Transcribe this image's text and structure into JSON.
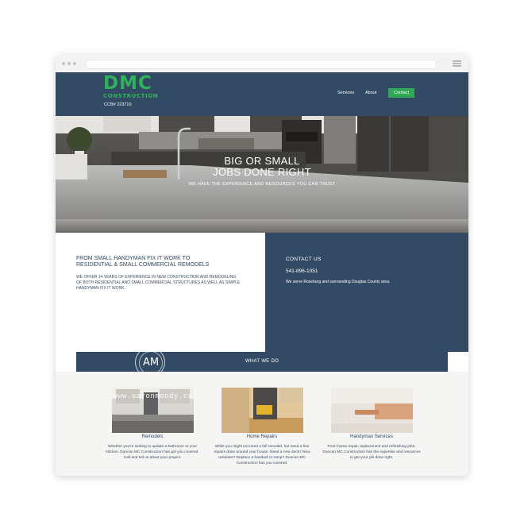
{
  "header": {
    "logo_main": "DMC",
    "logo_sub": "CONSTRUCTION",
    "ccb": "CCB# 223710",
    "nav": [
      "Services",
      "About"
    ],
    "contact_button": "Contact"
  },
  "hero": {
    "title_line1": "BIG OR SMALL",
    "title_line2": "JOBS DONE RIGHT",
    "subtitle": "WE HAVE THE EXPERIENCE AND RESOURCES YOU CAN TRUST"
  },
  "about": {
    "title_line1": "FROM SMALL HANDYMAN FIX IT WORK TO",
    "title_line2": "RESIDENTIAL & SMALL COMMERCIAL REMODELS",
    "text": "We offer 14 years of experience in new construction and remodeling of both residential and small commercial structures as well as simple handyman fix it work."
  },
  "contact": {
    "title": "CONTACT US",
    "phone": "541-896-1051",
    "area": "We serve Roseburg and surrounding Douglas County area."
  },
  "whatwedo": {
    "label": "WHAT WE DO",
    "watermark_monogram": "AM",
    "watermark_text": "www.aaronmoody.co"
  },
  "services": [
    {
      "title": "Remodels",
      "desc": "Whether you're looking to update a bathroom or your kitchen, Duncan MC Construction has got you covered. Call and tell us about your project."
    },
    {
      "title": "Home Repairs",
      "desc": "While you might not need a full remodel, but need a few repairs done around your house. Need a new deck? New windows? Replace a handrail or ramp? Duncan MC Construction has you covered."
    },
    {
      "title": "Handyman Services",
      "desc": "From home repair, replacement and refinishing jobs, Duncan MC Construction has the expertise and resources to get your job done right."
    }
  ],
  "colors": {
    "brand_navy": "#324a63",
    "brand_green": "#2fb35a"
  }
}
